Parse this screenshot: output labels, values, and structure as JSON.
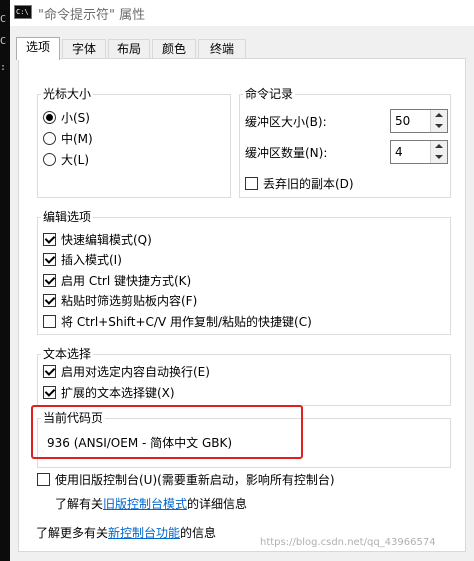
{
  "window": {
    "title": "\"命令提示符\" 属性",
    "icon": "console-icon"
  },
  "side_text": [
    "C",
    "C",
    ":"
  ],
  "tabs": [
    {
      "label": "选项",
      "active": true
    },
    {
      "label": "字体",
      "active": false
    },
    {
      "label": "布局",
      "active": false
    },
    {
      "label": "颜色",
      "active": false
    },
    {
      "label": "终端",
      "active": false
    }
  ],
  "cursor_size": {
    "title": "光标大小",
    "options": [
      {
        "label": "小(S)",
        "selected": true
      },
      {
        "label": "中(M)",
        "selected": false
      },
      {
        "label": "大(L)",
        "selected": false
      }
    ]
  },
  "command_history": {
    "title": "命令记录",
    "buffer_size_label": "缓冲区大小(B):",
    "buffer_size_value": "50",
    "buffer_count_label": "缓冲区数量(N):",
    "buffer_count_value": "4",
    "discard_old_label": "丢弃旧的副本(D)",
    "discard_old_checked": false
  },
  "edit_options": {
    "title": "编辑选项",
    "items": [
      {
        "label": "快速编辑模式(Q)",
        "checked": true
      },
      {
        "label": "插入模式(I)",
        "checked": true
      },
      {
        "label": "启用 Ctrl 键快捷方式(K)",
        "checked": true
      },
      {
        "label": "粘贴时筛选剪贴板内容(F)",
        "checked": true
      },
      {
        "label": "将 Ctrl+Shift+C/V 用作复制/粘贴的快捷键(C)",
        "checked": false
      }
    ]
  },
  "text_selection": {
    "title": "文本选择",
    "items": [
      {
        "label": "启用对选定内容自动换行(E)",
        "checked": true
      },
      {
        "label": "扩展的文本选择键(X)",
        "checked": true
      }
    ]
  },
  "code_page": {
    "title": "当前代码页",
    "value": "936   (ANSI/OEM - 简体中文 GBK)",
    "highlight_color": "#e02020"
  },
  "legacy": {
    "label": "使用旧版控制台(U)(需要重新启动，影响所有控制台)",
    "checked": false,
    "info_prefix": "了解有关",
    "info_link": "旧版控制台模式",
    "info_suffix": "的详细信息"
  },
  "new_features": {
    "prefix": "了解更多有关",
    "link": "新控制台功能",
    "suffix": "的信息"
  },
  "watermark": "https://blog.csdn.net/qq_43966574"
}
